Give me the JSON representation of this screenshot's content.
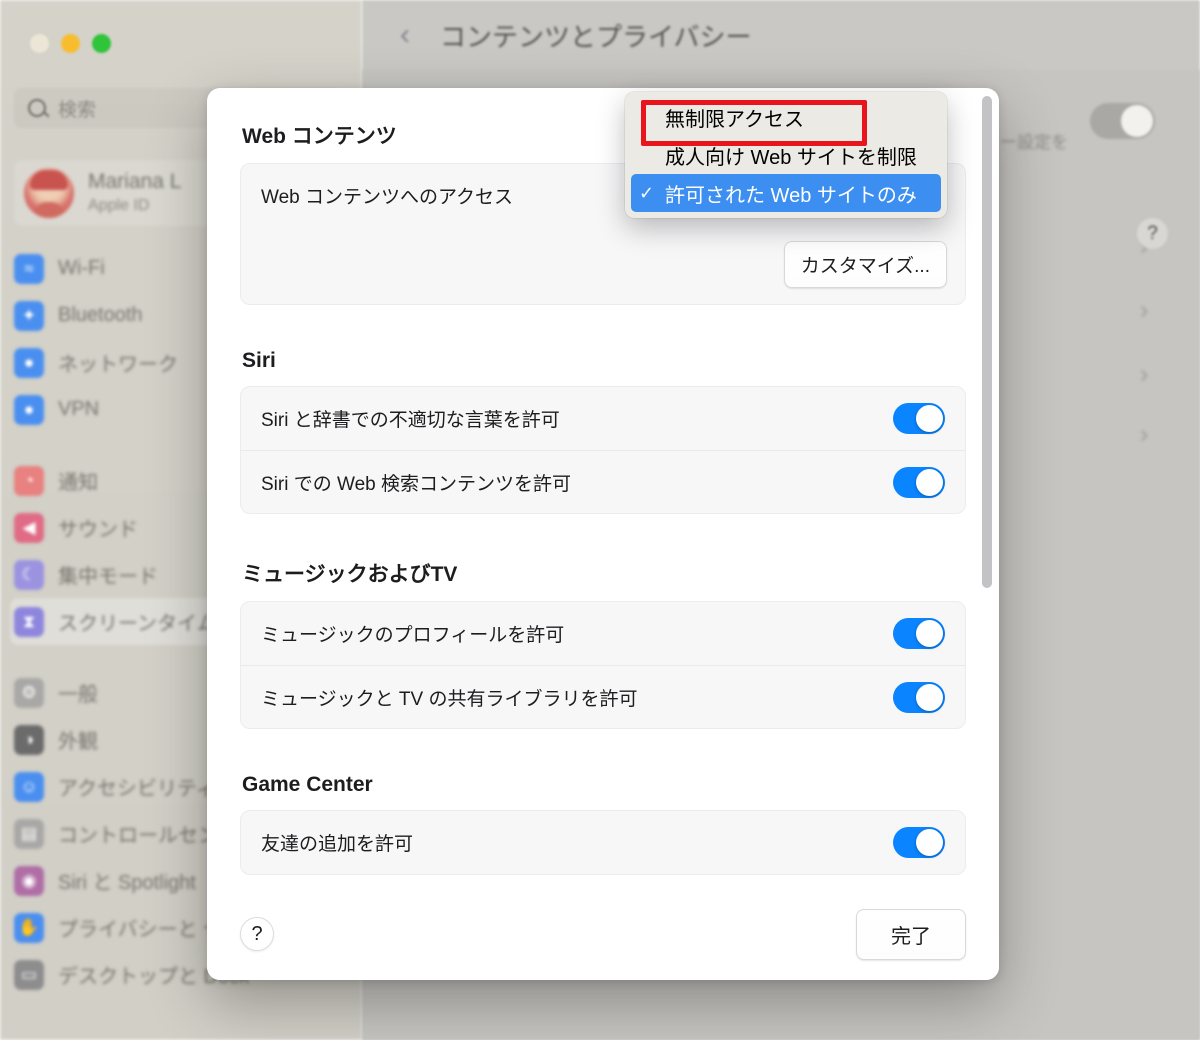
{
  "window": {
    "title": "コンテンツとプライバシー",
    "back_icon": "chevron-left-icon",
    "traffic_lights": [
      "close",
      "minimize",
      "zoom"
    ]
  },
  "sidebar": {
    "search": {
      "placeholder": "検索",
      "icon": "search-icon"
    },
    "profile": {
      "name": "Mariana L",
      "subtitle": "Apple ID",
      "avatar": "user-avatar"
    },
    "items": [
      {
        "label": "Wi-Fi",
        "icon": "wifi-icon",
        "color": "#4a8ff0",
        "glyph": "≈",
        "selected": false
      },
      {
        "label": "Bluetooth",
        "icon": "bluetooth-icon",
        "color": "#4a8ff0",
        "glyph": "✦",
        "selected": false
      },
      {
        "label": "ネットワーク",
        "icon": "network-icon",
        "color": "#4a8ff0",
        "glyph": "●",
        "selected": false
      },
      {
        "label": "VPN",
        "icon": "vpn-icon",
        "color": "#4a8ff0",
        "glyph": "●",
        "selected": false
      },
      {
        "label": "通知",
        "icon": "notifications-icon",
        "color": "#e8817f",
        "glyph": "◔",
        "selected": false
      },
      {
        "label": "サウンド",
        "icon": "sound-icon",
        "color": "#e06b86",
        "glyph": "◀",
        "selected": false
      },
      {
        "label": "集中モード",
        "icon": "focus-icon",
        "color": "#9b93e0",
        "glyph": "☾",
        "selected": false
      },
      {
        "label": "スクリーンタイム",
        "icon": "screen-time-icon",
        "color": "#8e86dd",
        "glyph": "⧗",
        "selected": true
      },
      {
        "label": "一般",
        "icon": "general-icon",
        "color": "#a9a8a6",
        "glyph": "⚙",
        "selected": false
      },
      {
        "label": "外観",
        "icon": "appearance-icon",
        "color": "#6b6b6b",
        "glyph": "◑",
        "selected": false
      },
      {
        "label": "アクセシビリティ",
        "icon": "accessibility-icon",
        "color": "#4a8ff0",
        "glyph": "☺",
        "selected": false
      },
      {
        "label": "コントロールセンター",
        "icon": "control-center-icon",
        "color": "#a9a8a6",
        "glyph": "▤",
        "selected": false
      },
      {
        "label": "Siri と Spotlight",
        "icon": "siri-spotlight-icon",
        "color": "#b06ea6",
        "glyph": "◉",
        "selected": false
      },
      {
        "label": "プライバシーと\nセキュリティ",
        "icon": "privacy-security-icon",
        "color": "#4a8ff0",
        "glyph": "✋",
        "selected": false
      },
      {
        "label": "デスクトップと Dock",
        "icon": "desktop-dock-icon",
        "color": "#8d8d8d",
        "glyph": "▭",
        "selected": false
      }
    ]
  },
  "background_panel": {
    "partial_text": "ー設定を",
    "toggle_state": "off",
    "chevron_icon": "chevron-right-icon",
    "chevron_count": 4,
    "help_label": "?"
  },
  "sheet": {
    "sections": [
      {
        "title": "Web コンテンツ",
        "rows": [
          {
            "label": "Web コンテンツへのアクセス",
            "control": "popup-button"
          }
        ],
        "button": {
          "label": "カスタマイズ..."
        }
      },
      {
        "title": "Siri",
        "rows": [
          {
            "label": "Siri と辞書での不適切な言葉を許可",
            "control": "toggle",
            "state": "on"
          },
          {
            "label": "Siri での Web 検索コンテンツを許可",
            "control": "toggle",
            "state": "on"
          }
        ]
      },
      {
        "title": "ミュージックおよびTV",
        "rows": [
          {
            "label": "ミュージックのプロフィールを許可",
            "control": "toggle",
            "state": "on"
          },
          {
            "label": "ミュージックと TV の共有ライブラリを許可",
            "control": "toggle",
            "state": "on"
          }
        ]
      },
      {
        "title": "Game Center",
        "rows": [
          {
            "label": "友達の追加を許可",
            "control": "toggle",
            "state": "on"
          }
        ]
      }
    ],
    "footer": {
      "help_label": "?",
      "done_label": "完了"
    }
  },
  "dropdown": {
    "options": [
      {
        "label": "無制限アクセス",
        "selected": false,
        "highlighted_by_annotation": true
      },
      {
        "label": "成人向け Web サイトを制限",
        "selected": false,
        "highlighted_by_annotation": false
      },
      {
        "label": "許可された Web サイトのみ",
        "selected": true,
        "highlighted_by_annotation": false
      }
    ],
    "check_glyph": "✓",
    "selected_color": "#3c8ef0"
  },
  "annotation": {
    "type": "red-rectangle-highlight",
    "color": "#e8151c",
    "target": "無制限アクセス"
  }
}
